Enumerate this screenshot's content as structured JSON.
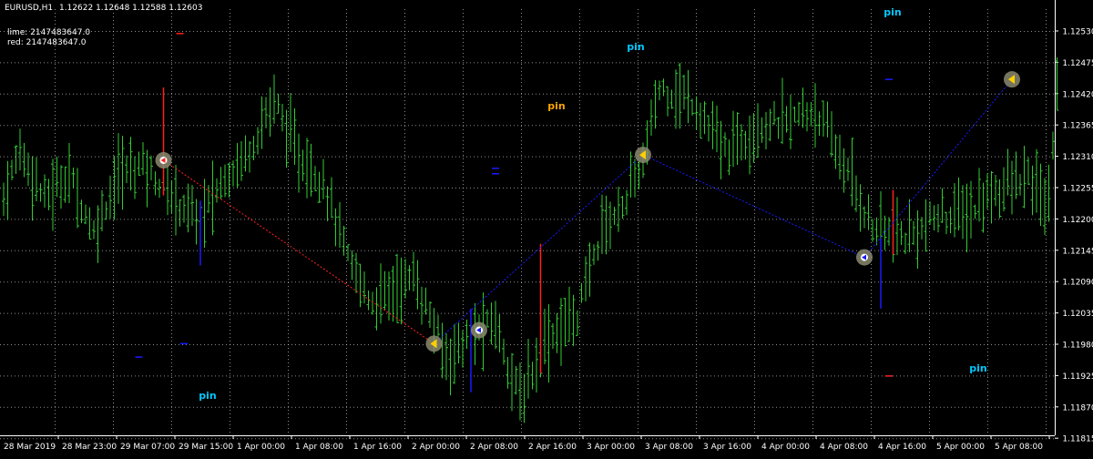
{
  "header": {
    "symbol": "EURUSD,H1",
    "quote": "1.12622 1.12648 1.12588 1.12603",
    "line1": "lime: 2147483647.0",
    "line2": "red: 2147483647.0"
  },
  "colors": {
    "background": "#000000",
    "grid": "#ffffff",
    "bull": "#33cc33",
    "bear": "#ff2020",
    "zigzag_red": "#ff2020",
    "zigzag_blue": "#1a1aff",
    "pin_cyan": "#00c8ff",
    "pin_orange": "#ffa500",
    "axis_text": "#ffffff"
  },
  "price_axis": [
    "1.12530",
    "1.12475",
    "1.12420",
    "1.12365",
    "1.12310",
    "1.12255",
    "1.12200",
    "1.12145",
    "1.12090",
    "1.12035",
    "1.11980",
    "1.11925",
    "1.11870",
    "1.11815"
  ],
  "time_axis": [
    "28 Mar 2019",
    "28 Mar 23:00",
    "29 Mar 07:00",
    "29 Mar 15:00",
    "1 Apr 00:00",
    "1 Apr 08:00",
    "1 Apr 16:00",
    "2 Apr 00:00",
    "2 Apr 08:00",
    "2 Apr 16:00",
    "3 Apr 00:00",
    "3 Apr 08:00",
    "3 Apr 16:00",
    "4 Apr 00:00",
    "4 Apr 08:00",
    "4 Apr 16:00",
    "5 Apr 00:00",
    "5 Apr 08:00"
  ],
  "pin_labels": [
    {
      "text": "pin",
      "color": "cyan"
    },
    {
      "text": "pin",
      "color": "cyan"
    },
    {
      "text": "pin",
      "color": "orange"
    },
    {
      "text": "pin",
      "color": "cyan"
    },
    {
      "text": "pin",
      "color": "cyan"
    }
  ],
  "chart_data": {
    "type": "ohlc",
    "symbol": "EURUSD",
    "timeframe": "H1",
    "y_range": [
      1.11815,
      1.1258
    ],
    "anchors": [
      [
        0,
        1.12255
      ],
      [
        4,
        1.12345
      ],
      [
        10,
        1.12255
      ],
      [
        16,
        1.123
      ],
      [
        22,
        1.1219
      ],
      [
        28,
        1.123
      ],
      [
        34,
        1.1232
      ],
      [
        40,
        1.12265
      ],
      [
        48,
        1.12215
      ],
      [
        54,
        1.12295
      ],
      [
        60,
        1.12345
      ],
      [
        66,
        1.1244
      ],
      [
        72,
        1.1233
      ],
      [
        78,
        1.1229
      ],
      [
        84,
        1.1214
      ],
      [
        90,
        1.1206
      ],
      [
        100,
        1.1211
      ],
      [
        108,
        1.1196
      ],
      [
        114,
        1.12
      ],
      [
        120,
        1.12025
      ],
      [
        126,
        1.1188
      ],
      [
        132,
        1.1199
      ],
      [
        140,
        1.1204
      ],
      [
        146,
        1.122
      ],
      [
        150,
        1.1223
      ],
      [
        156,
        1.1232
      ],
      [
        160,
        1.1246
      ],
      [
        168,
        1.12435
      ],
      [
        176,
        1.1234
      ],
      [
        184,
        1.1239
      ],
      [
        192,
        1.124
      ],
      [
        198,
        1.1242
      ],
      [
        206,
        1.123
      ],
      [
        212,
        1.122
      ],
      [
        220,
        1.1218
      ],
      [
        228,
        1.1222
      ],
      [
        236,
        1.1223
      ],
      [
        242,
        1.1227
      ],
      [
        250,
        1.1229
      ],
      [
        255,
        1.1224
      ],
      [
        257,
        1.1248
      ]
    ],
    "red_spikes": [
      [
        39,
        1.1246,
        1.1226
      ],
      [
        131,
        1.1217,
        1.1193
      ],
      [
        217,
        1.1227,
        1.1215
      ]
    ],
    "blue_bars": [
      [
        48,
        1.1225,
        1.1213
      ],
      [
        114,
        1.1205,
        1.11895
      ],
      [
        120,
        1.1231,
        1.1231
      ],
      [
        214,
        1.1218,
        1.1205
      ]
    ],
    "zigzag_red": [
      [
        39,
        1.12325
      ],
      [
        105,
        1.11985
      ]
    ],
    "zigzag_blue": [
      [
        105,
        1.11985
      ],
      [
        156,
        1.12335
      ],
      [
        210,
        1.12145
      ],
      [
        246,
        1.12475
      ]
    ],
    "markers": [
      {
        "bar": 39,
        "price": 1.12325,
        "kind": "red-arrow"
      },
      {
        "bar": 105,
        "price": 1.11985,
        "kind": "triangle"
      },
      {
        "bar": 116,
        "price": 1.1201,
        "kind": "blue-arrow"
      },
      {
        "bar": 156,
        "price": 1.12335,
        "kind": "triangle"
      },
      {
        "bar": 210,
        "price": 1.12145,
        "kind": "blue-arrow"
      },
      {
        "bar": 246,
        "price": 1.12475,
        "kind": "triangle"
      }
    ]
  }
}
